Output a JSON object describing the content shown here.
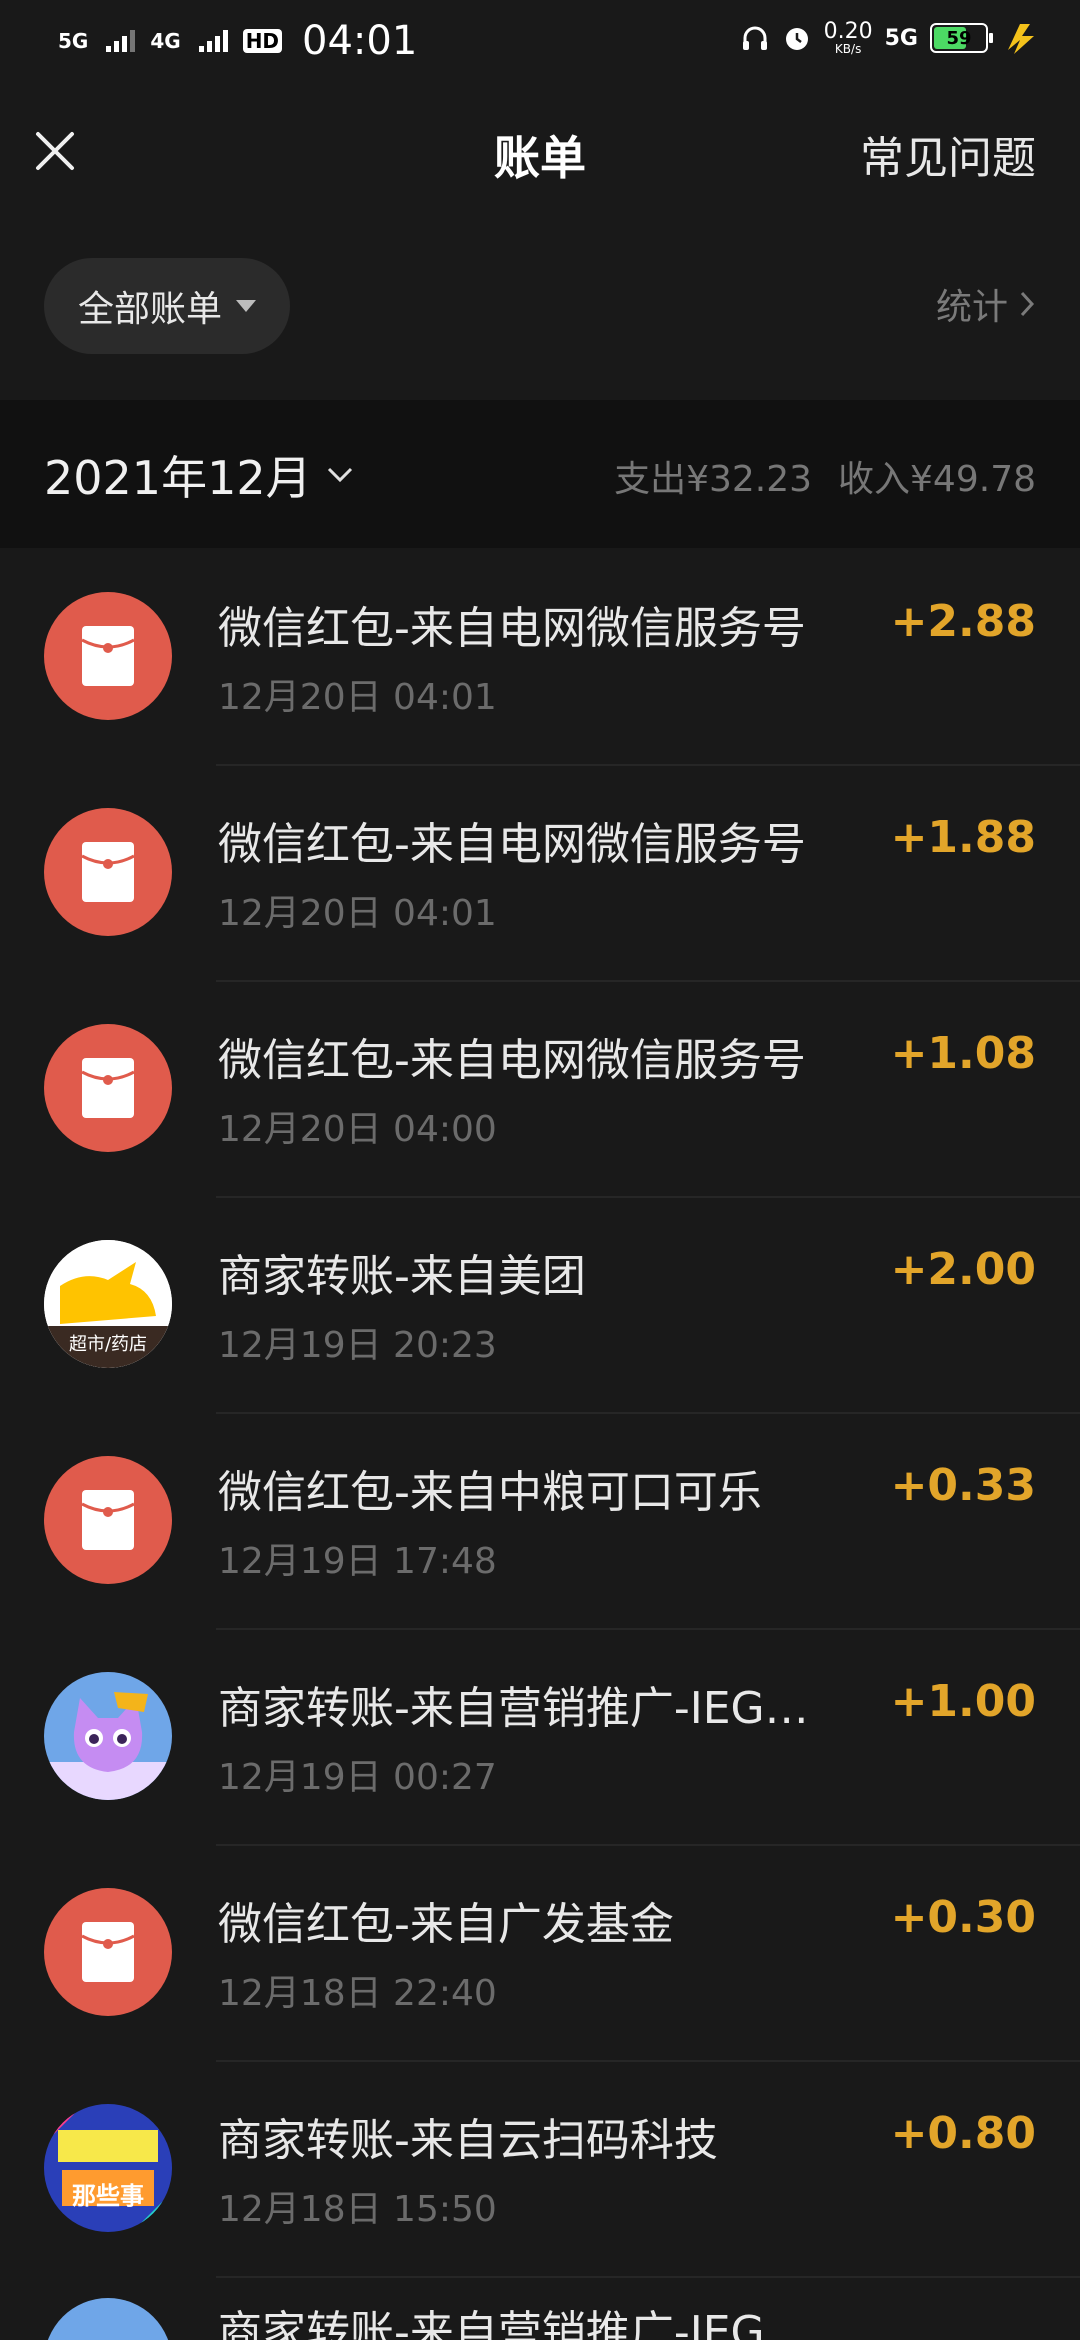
{
  "status_bar": {
    "net1": "5G",
    "net2": "4G",
    "hd": "HD",
    "time": "04:01",
    "speed": "0.20",
    "speed_unit": "KB/s",
    "net3": "5G",
    "battery": "59",
    "icons": [
      "headphones-icon",
      "alarm-icon",
      "charging-bolt-icon"
    ]
  },
  "header": {
    "close_icon": "close-icon",
    "title": "账单",
    "faq": "常见问题"
  },
  "filter": {
    "label": "全部账单",
    "stats": "统计"
  },
  "month_bar": {
    "month": "2021年12月",
    "expense": "支出¥32.23",
    "income": "收入¥49.78"
  },
  "transactions": [
    {
      "title": "微信红包-来自电网微信服务号",
      "time": "12月20日 04:01",
      "amount": "+2.88",
      "icon": "red-packet-icon"
    },
    {
      "title": "微信红包-来自电网微信服务号",
      "time": "12月20日 04:01",
      "amount": "+1.88",
      "icon": "red-packet-icon"
    },
    {
      "title": "微信红包-来自电网微信服务号",
      "time": "12月20日 04:00",
      "amount": "+1.08",
      "icon": "red-packet-icon"
    },
    {
      "title": "商家转账-来自美团",
      "time": "12月19日 20:23",
      "amount": "+2.00",
      "icon": "meituan-logo",
      "logo_text": "超市/药店"
    },
    {
      "title": "微信红包-来自中粮可口可乐",
      "time": "12月19日 17:48",
      "amount": "+0.33",
      "icon": "red-packet-icon"
    },
    {
      "title": "商家转账-来自营销推广-IEG…",
      "time": "12月19日 00:27",
      "amount": "+1.00",
      "icon": "cartoon-cat-avatar"
    },
    {
      "title": "微信红包-来自广发基金",
      "time": "12月18日 22:40",
      "amount": "+0.30",
      "icon": "red-packet-icon"
    },
    {
      "title": "商家转账-来自云扫码科技",
      "time": "12月18日 15:50",
      "amount": "+0.80",
      "icon": "colorful-banner-avatar",
      "logo_text": "那些事"
    }
  ],
  "partial_row": {
    "title": "商家转账-来自营销推广-IEG…"
  },
  "colors": {
    "background": "#191919",
    "amount": "#e2a52a",
    "red_packet": "#e05b4c"
  }
}
